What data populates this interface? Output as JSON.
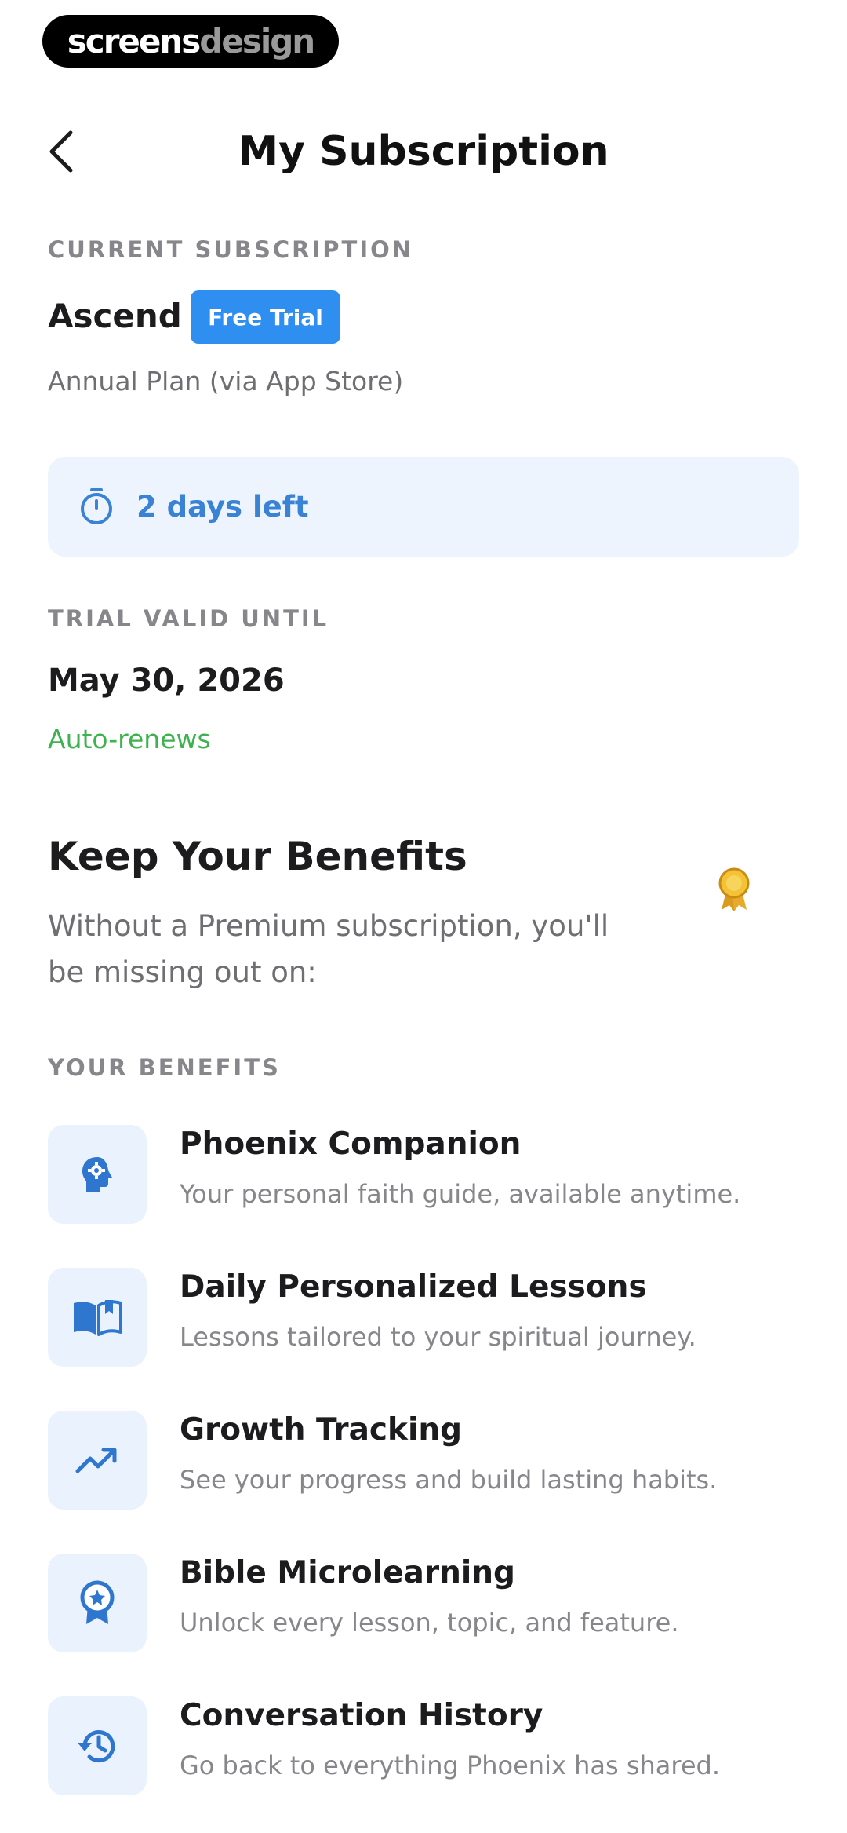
{
  "watermark": {
    "part1": "screens",
    "part2": "design"
  },
  "header": {
    "title": "My Subscription"
  },
  "current": {
    "section_label": "CURRENT SUBSCRIPTION",
    "plan_name": "Ascend",
    "badge": "Free Trial",
    "plan_detail": "Annual Plan (via App Store)"
  },
  "trial": {
    "days_left": "2 days left",
    "valid_label": "TRIAL VALID UNTIL",
    "valid_date": "May 30, 2026",
    "renew_status": "Auto-renews"
  },
  "keep": {
    "heading": "Keep Your Benefits",
    "subtitle": "Without a Premium subscription, you'll be missing out on:"
  },
  "benefits": {
    "section_label": "YOUR BENEFITS",
    "items": [
      {
        "icon": "head-gear-icon",
        "title": "Phoenix Companion",
        "desc": "Your personal faith guide, available anytime."
      },
      {
        "icon": "open-book-icon",
        "title": "Daily Personalized Lessons",
        "desc": "Lessons tailored to your spiritual journey."
      },
      {
        "icon": "trending-up-icon",
        "title": "Growth Tracking",
        "desc": "See your progress and build lasting habits."
      },
      {
        "icon": "award-ribbon-icon",
        "title": "Bible Microlearning",
        "desc": "Unlock every lesson, topic, and feature."
      },
      {
        "icon": "history-icon",
        "title": "Conversation History",
        "desc": "Go back to everything Phoenix has shared."
      }
    ]
  },
  "colors": {
    "accent": "#2f8ff0",
    "accent_text": "#3a82d4",
    "renew_green": "#3fb24f",
    "icon_bg": "#eaf2fd",
    "muted": "#86868b"
  }
}
